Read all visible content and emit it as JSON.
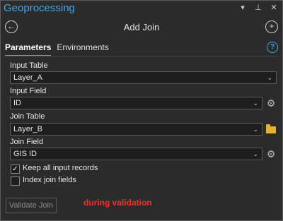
{
  "window": {
    "title": "Geoprocessing"
  },
  "header": {
    "title": "Add Join"
  },
  "tabs": [
    {
      "label": "Parameters",
      "active": true
    },
    {
      "label": "Environments",
      "active": false
    }
  ],
  "form": {
    "input_table": {
      "label": "Input Table",
      "value": "Layer_A"
    },
    "input_field": {
      "label": "Input Field",
      "value": "ID"
    },
    "join_table": {
      "label": "Join Table",
      "value": "Layer_B"
    },
    "join_field": {
      "label": "Join Field",
      "value": "GIS ID"
    },
    "keep_all": {
      "label": "Keep all input records",
      "checked": true
    },
    "index_join": {
      "label": "Index join fields",
      "checked": false
    }
  },
  "footer": {
    "validate_label": "Validate Join",
    "note": "during validation"
  },
  "icons": {
    "dropdown": "chevron-down-icon",
    "pin": "pin-icon",
    "close": "close-icon",
    "back": "back-icon",
    "add": "add-icon",
    "help": "help-icon",
    "gear": "gear-icon",
    "folder": "folder-icon"
  },
  "colors": {
    "accent": "#4aa3df",
    "note": "#ff2a2a",
    "background": "#2b2b2b"
  }
}
